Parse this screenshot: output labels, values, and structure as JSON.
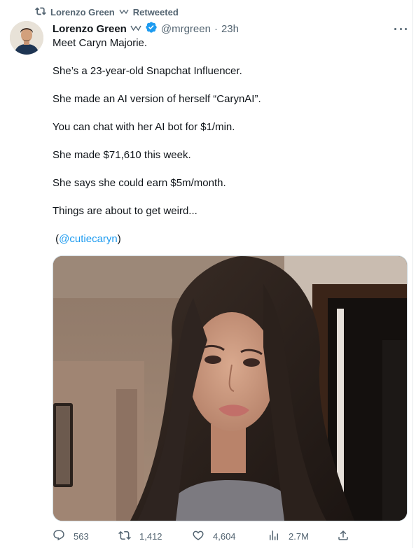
{
  "retweet": {
    "name": "Lorenzo Green",
    "label": "Retweeted"
  },
  "tweet": {
    "author_name": "Lorenzo Green",
    "handle": "@mrgreen",
    "separator": "·",
    "time": "23h",
    "lines": [
      "Meet Caryn Majorie.",
      "She’s a 23-year-old Snapchat Influencer.",
      "She made an AI version of herself “CarynAI”.",
      "You can chat with her AI bot for $1/min.",
      "She made $71,610 this week.",
      "She says she could earn $5m/month.",
      "Things are about to get weird..."
    ],
    "mention_open": "(",
    "mention": "@cutiecaryn",
    "mention_close": ")"
  },
  "actions": {
    "replies": "563",
    "retweets": "1,412",
    "likes": "4,604",
    "views": "2.7M"
  },
  "colors": {
    "accent": "#1d9bf0",
    "muted": "#536471",
    "text": "#0f1419"
  }
}
